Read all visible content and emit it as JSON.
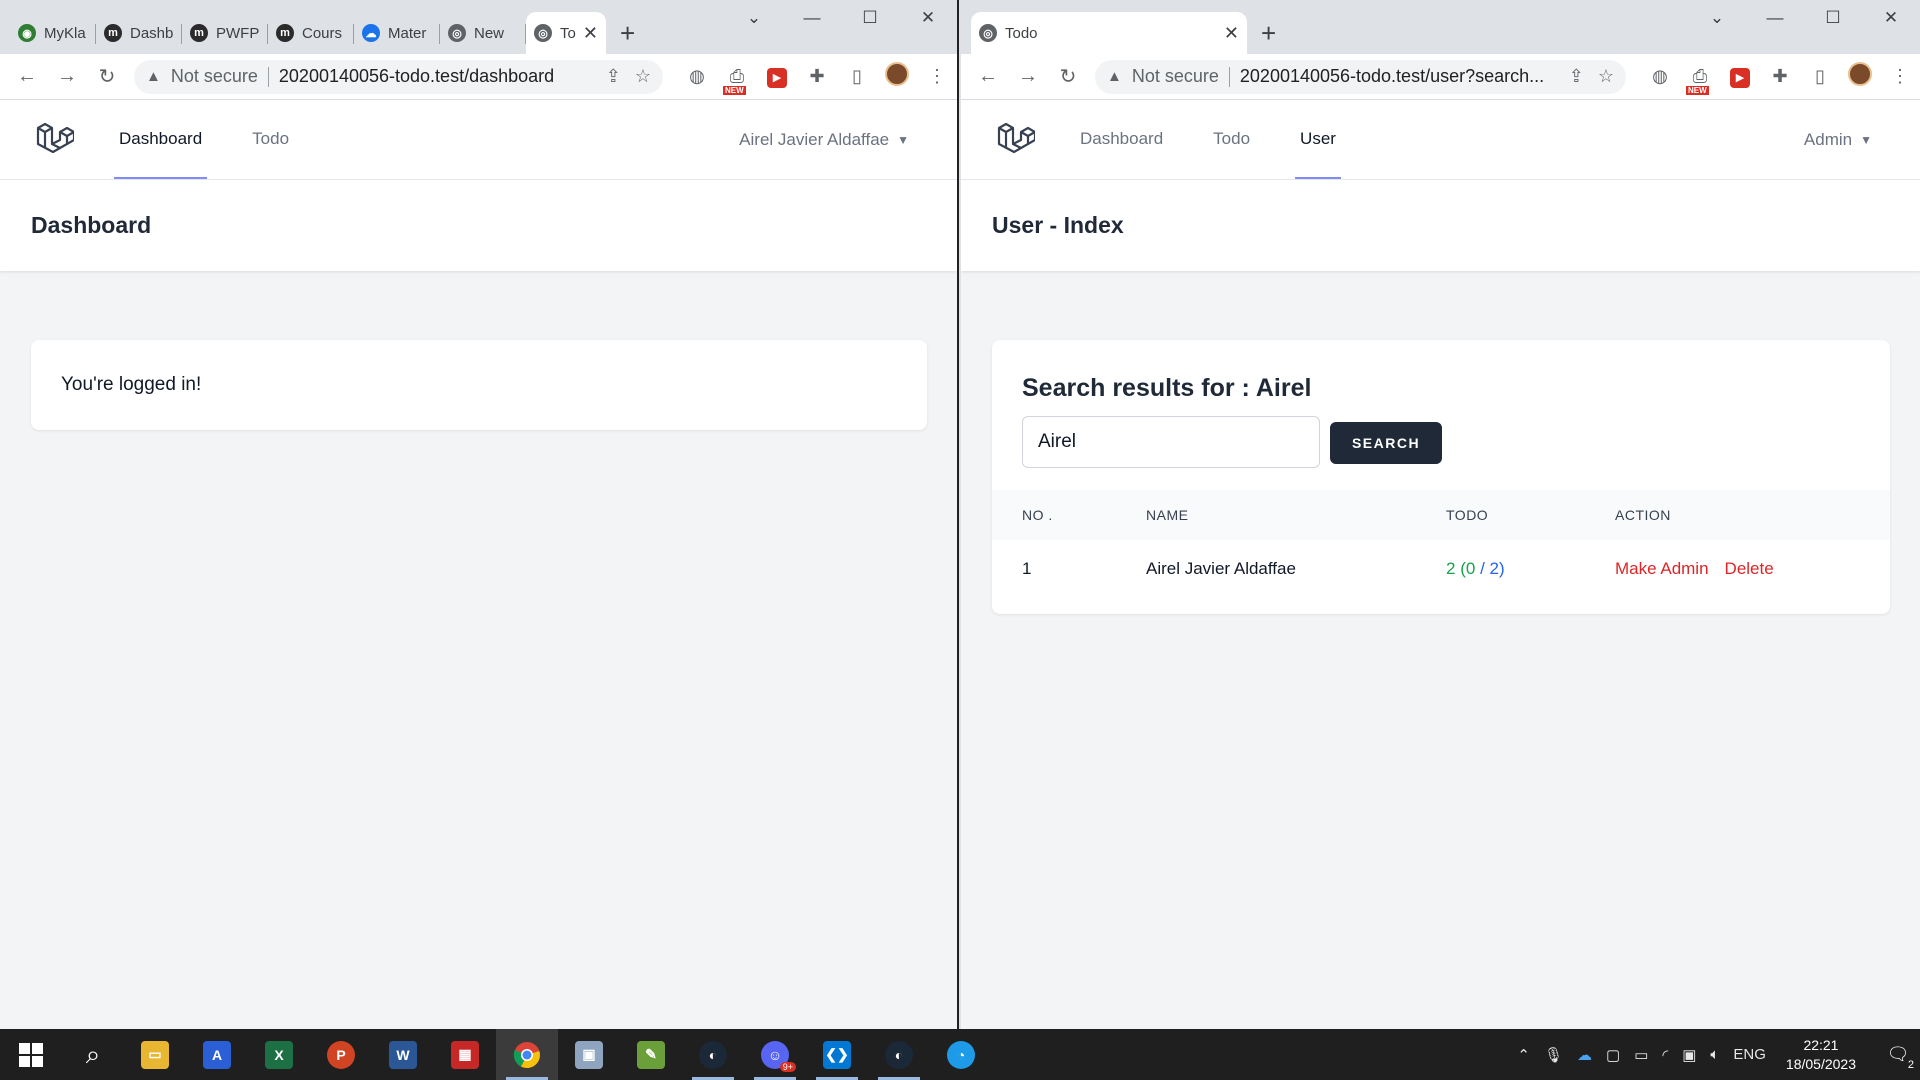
{
  "left_window": {
    "tabs": [
      {
        "label": "MyKla",
        "favicon_color": "#2e7d32"
      },
      {
        "label": "Dashb",
        "favicon_color": "#2b2b2b"
      },
      {
        "label": "PWFP",
        "favicon_color": "#2b2b2b"
      },
      {
        "label": "Cours",
        "favicon_color": "#2b2b2b"
      },
      {
        "label": "Mater",
        "favicon_color": "#1a73e8"
      },
      {
        "label": "New",
        "favicon_color": "#5f6368"
      },
      {
        "label": "To",
        "favicon_color": "#5f6368"
      }
    ],
    "omnibox": {
      "security": "Not secure",
      "url": "20200140056-todo.test/dashboard"
    },
    "app": {
      "nav": [
        "Dashboard",
        "Todo"
      ],
      "active_nav": "Dashboard",
      "user_name": "Airel Javier Aldaffae",
      "header": "Dashboard",
      "message": "You're logged in!"
    }
  },
  "right_window": {
    "tabs": [
      {
        "label": "Todo",
        "favicon_color": "#5f6368"
      }
    ],
    "omnibox": {
      "security": "Not secure",
      "url": "20200140056-todo.test/user?search..."
    },
    "app": {
      "nav": [
        "Dashboard",
        "Todo",
        "User"
      ],
      "active_nav": "User",
      "user_name": "Admin",
      "header": "User - Index",
      "search_title": "Search results for : Airel",
      "search_value": "Airel",
      "search_button": "SEARCH",
      "table": {
        "headers": [
          "NO .",
          "NAME",
          "TODO",
          "ACTION"
        ],
        "rows": [
          {
            "no": "1",
            "name": "Airel Javier Aldaffae",
            "todo_total": "2",
            "todo_done": "0",
            "todo_all": "2",
            "action_make_admin": "Make Admin",
            "action_delete": "Delete"
          }
        ]
      }
    }
  },
  "extensions": {
    "new_badge": "NEW"
  },
  "taskbar": {
    "apps": [
      "start",
      "search",
      "file-explorer",
      "affinity",
      "excel",
      "powerpoint",
      "word",
      "photos",
      "chrome",
      "image-viewer",
      "image-editor",
      "steam",
      "discord",
      "vscode",
      "steam-2",
      "edge-dev"
    ],
    "discord_badge": "9+",
    "tray": {
      "language": "ENG",
      "time": "22:21",
      "date": "18/05/2023",
      "notifications": "2"
    }
  },
  "colors": {
    "accent": "#818cf8",
    "dark_button": "#1f2937",
    "todo_done": "#16a34a",
    "todo_all": "#2563eb",
    "danger": "#dc2626"
  }
}
